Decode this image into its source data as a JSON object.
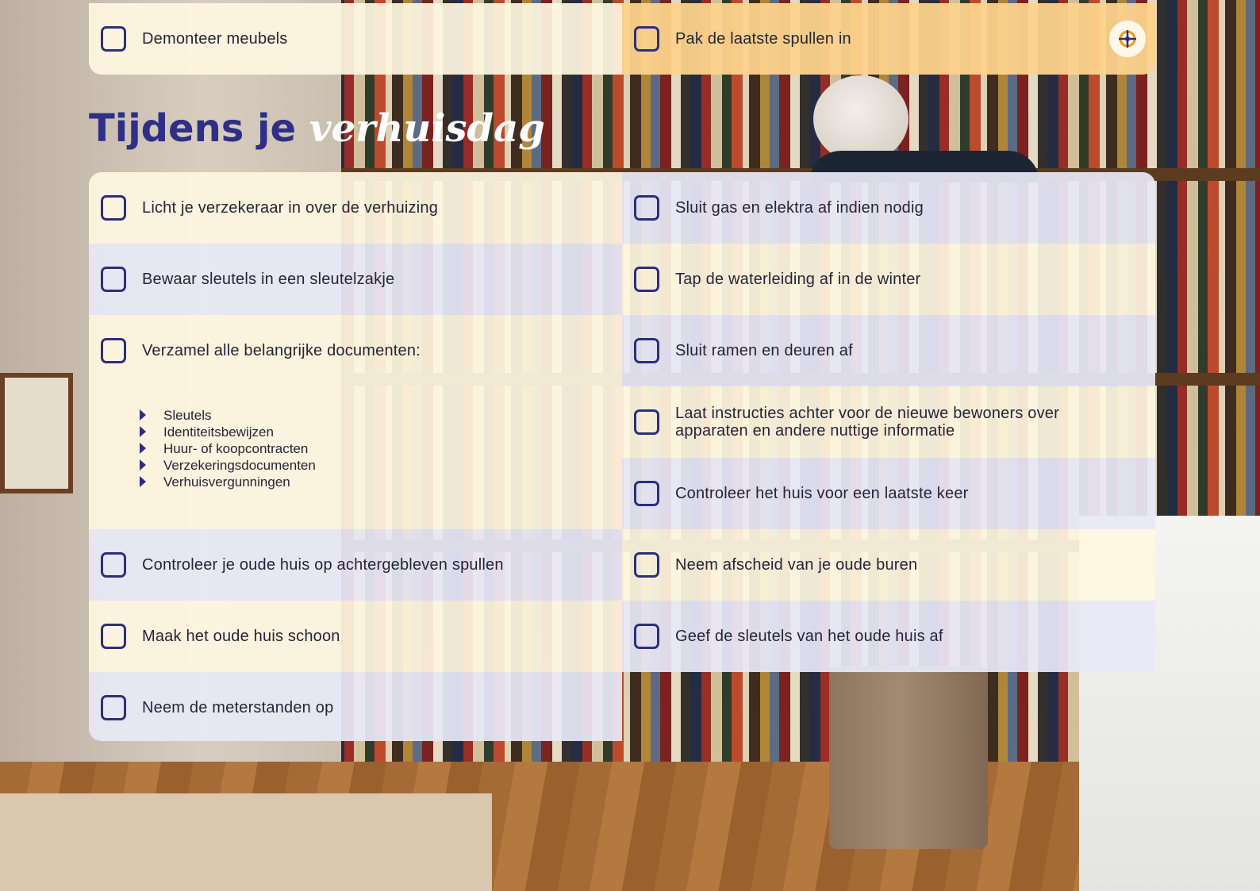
{
  "top_row": {
    "left": {
      "label": "Demonteer meubels"
    },
    "right": {
      "label": "Pak de laatste spullen in",
      "icon": "compass-icon"
    }
  },
  "heading": {
    "part1": "Tijdens je",
    "part2": "verhuisdag"
  },
  "left_column": {
    "item1": "Licht je verzekeraar in over de verhuizing",
    "item2": "Bewaar sleutels in een sleutelzakje",
    "item3": "Verzamel alle belangrijke documenten:",
    "sublist": [
      "Sleutels",
      "Identiteitsbewijzen",
      "Huur- of koopcontracten",
      "Verzekeringsdocumenten",
      "Verhuisvergunningen"
    ],
    "item4": "Controleer je oude huis op achtergebleven spullen",
    "item5": "Maak het oude huis schoon",
    "item6": "Neem de meterstanden op"
  },
  "right_column": {
    "item1": "Sluit gas en elektra af indien nodig",
    "item2": "Tap de waterleiding af in de winter",
    "item3": "Sluit ramen en deuren af",
    "item4_line1": "Laat instructies achter voor de nieuwe bewoners over",
    "item4_line2": "apparaten en andere nuttige informatie",
    "item5": "Controleer het huis voor een laatste keer",
    "item6": "Neem afscheid van je oude buren",
    "item7": "Geef de sleutels van het oude huis af"
  },
  "colors": {
    "navy": "#2c2f7a",
    "cream": "#fef6e0",
    "lavender": "#e8e8f7",
    "orange": "#fcd38c"
  }
}
